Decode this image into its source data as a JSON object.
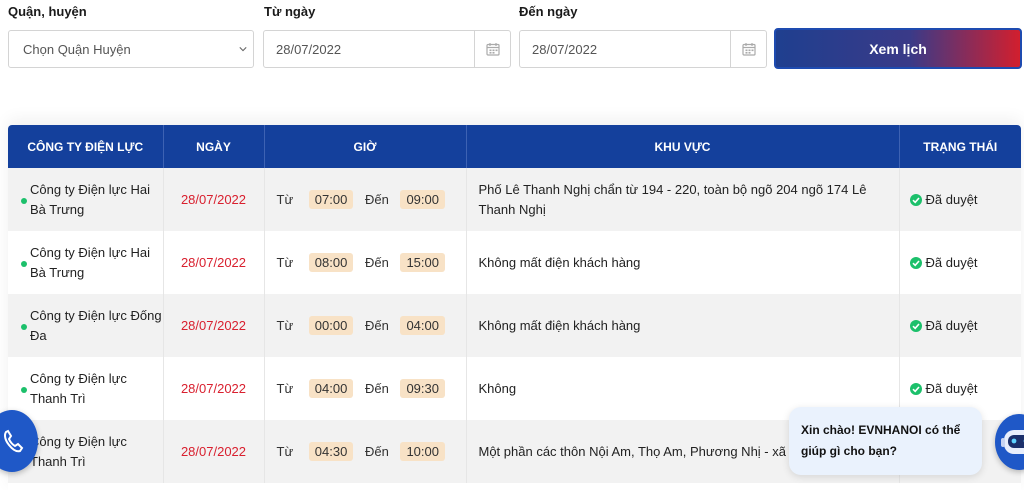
{
  "filters": {
    "district_label": "Quận, huyện",
    "district_value": "Chọn Quận Huyện",
    "from_label": "Từ ngày",
    "from_value": "28/07/2022",
    "to_label": "Đến ngày",
    "to_value": "28/07/2022",
    "view_button": "Xem lịch"
  },
  "table": {
    "headers": [
      "CÔNG TY ĐIỆN LỰC",
      "NGÀY",
      "GIỜ",
      "KHU VỰC",
      "TRẠNG THÁI"
    ],
    "from_word": "Từ",
    "to_word": "Đến",
    "rows": [
      {
        "company": "Công ty Điện lực Hai Bà Trưng",
        "date": "28/07/2022",
        "start": "07:00",
        "end": "09:00",
        "area": "Phố Lê Thanh Nghị chẩn từ 194 - 220, toàn bộ ngõ 204 ngõ 174 Lê Thanh Nghị",
        "status": "Đã duyệt"
      },
      {
        "company": "Công ty Điện lực Hai Bà Trưng",
        "date": "28/07/2022",
        "start": "08:00",
        "end": "15:00",
        "area": "Không mất điện khách hàng",
        "status": "Đã duyệt"
      },
      {
        "company": "Công ty Điện lực Đống Đa",
        "date": "28/07/2022",
        "start": "00:00",
        "end": "04:00",
        "area": "Không mất điện khách hàng",
        "status": "Đã duyệt"
      },
      {
        "company": "Công ty Điện lực Thanh Trì",
        "date": "28/07/2022",
        "start": "04:00",
        "end": "09:30",
        "area": "Không",
        "status": "Đã duyệt"
      },
      {
        "company": "Công ty Điện lực Thanh Trì",
        "date": "28/07/2022",
        "start": "04:30",
        "end": "10:00",
        "area": "Một phần các thôn Nội Am, Thọ Am, Phương Nhị - xã Li",
        "status": ""
      }
    ]
  },
  "chat": {
    "bubble_text": "Xin chào! EVNHANOI có thể giúp gì cho bạn?"
  },
  "icons": {
    "select_chevron": "chevron-down-icon",
    "calendar": "calendar-icon",
    "status_ok": "check-circle-icon",
    "phone": "phone-icon",
    "bot": "robot-avatar-icon"
  },
  "colors": {
    "header_blue": "#14409c",
    "date_red": "#d9202f",
    "status_green": "#1cc06b",
    "time_pill": "#f8e2c6"
  }
}
